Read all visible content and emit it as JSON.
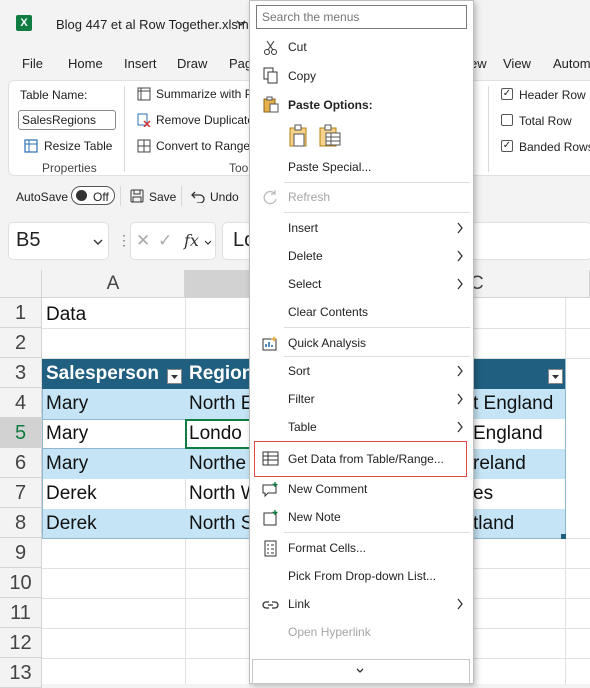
{
  "titlebar": {
    "filename": "Blog 447 et al  Row Together.xlsm"
  },
  "tabs": [
    "File",
    "Home",
    "Insert",
    "Draw",
    "Pag",
    "ew",
    "View",
    "Autom"
  ],
  "ribbon": {
    "table_name_label": "Table Name:",
    "table_name_value": "SalesRegions",
    "resize_table": "Resize Table",
    "properties_group": "Properties",
    "summarize": "Summarize with P",
    "remove_duplicates": "Remove Duplicate",
    "convert_to_range": "Convert to Range",
    "tools_group": "Tool",
    "header_row": "Header Row",
    "total_row": "Total Row",
    "banded_rows": "Banded Rows",
    "header_row_checked": true,
    "total_row_checked": false,
    "banded_rows_checked": true
  },
  "qat": {
    "autosave": "AutoSave",
    "autosave_state": "Off",
    "save": "Save",
    "undo": "Undo"
  },
  "formula_bar": {
    "cell_ref": "B5",
    "content_partial": "Lo"
  },
  "grid": {
    "columns": [
      "A",
      "",
      "C"
    ],
    "rows": [
      "1",
      "2",
      "3",
      "4",
      "5",
      "6",
      "7",
      "8",
      "9",
      "10",
      "11",
      "12",
      "13"
    ],
    "a1": "Data",
    "table_header": [
      "Salesperson",
      "Region"
    ],
    "table_rows": [
      {
        "a": "Mary",
        "b": "North E",
        "c": "t England"
      },
      {
        "a": "Mary",
        "b": "Londo",
        "c": " England"
      },
      {
        "a": "Mary",
        "b": "Northe",
        "c": "reland"
      },
      {
        "a": "Derek",
        "b": "North W",
        "c": "es"
      },
      {
        "a": "Derek",
        "b": "North S",
        "c": "tland"
      }
    ]
  },
  "menu": {
    "search_placeholder": "Search the menus",
    "cut": "Cut",
    "copy": "Copy",
    "paste_options": "Paste Options:",
    "paste_special": "Paste Special...",
    "refresh": "Refresh",
    "insert": "Insert",
    "delete": "Delete",
    "select": "Select",
    "clear_contents": "Clear Contents",
    "quick_analysis": "Quick Analysis",
    "sort": "Sort",
    "filter": "Filter",
    "table": "Table",
    "get_data": "Get Data from Table/Range...",
    "new_comment": "New Comment",
    "new_note": "New Note",
    "format_cells": "Format Cells...",
    "pick_from_list": "Pick From Drop-down List...",
    "link": "Link",
    "open_hyperlink": "Open Hyperlink"
  },
  "colors": {
    "excel_green": "#107c41",
    "table_header": "#215f80",
    "band": "#c5e4f5",
    "highlight": "#e04848"
  }
}
